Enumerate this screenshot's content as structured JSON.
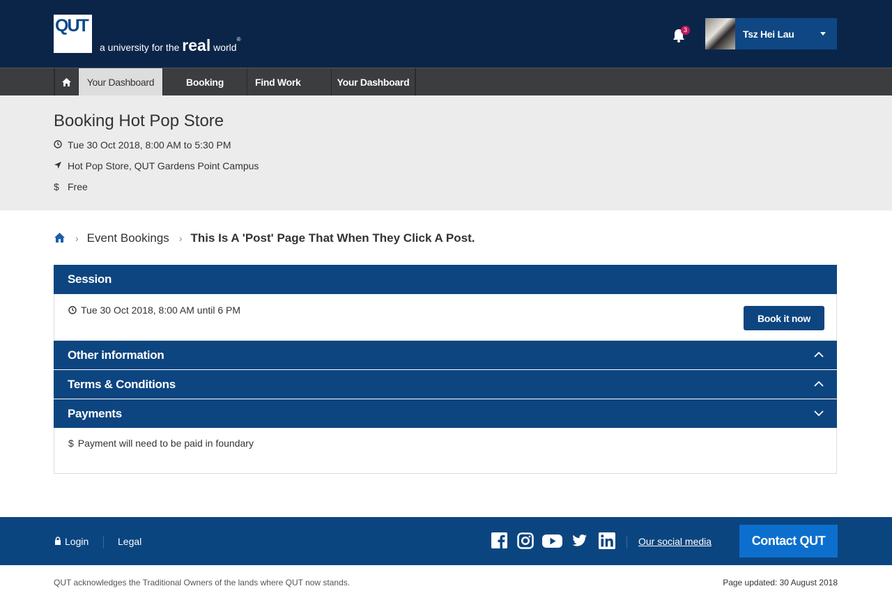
{
  "header": {
    "logo_text": "QUT",
    "tagline_prefix": "a university for the",
    "tagline_real": "real",
    "tagline_world": "world",
    "tagline_reg": "®",
    "notification_count": "3",
    "user_name": "Tsz Hei Lau"
  },
  "nav": {
    "items": [
      {
        "label": "Your Dashboard"
      },
      {
        "label": "Booking"
      },
      {
        "label": "Find Work"
      },
      {
        "label": "Your Dashboard"
      }
    ]
  },
  "event": {
    "title": "Booking Hot Pop Store",
    "datetime": "Tue 30 Oct 2018, 8:00 AM to 5:30 PM",
    "location": "Hot Pop Store, QUT Gardens Point Campus",
    "price": "Free"
  },
  "breadcrumb": {
    "items": [
      "Event Bookings",
      "This Is A 'Post' Page That When They Click A Post."
    ]
  },
  "session": {
    "heading": "Session",
    "time": "Tue 30 Oct 2018, 8:00 AM until 6 PM",
    "book_label": "Book it now"
  },
  "sections": {
    "other": "Other information",
    "terms": "Terms & Conditions",
    "payments": "Payments",
    "payment_note": "Payment will need to be paid in foundary"
  },
  "footer": {
    "login": "Login",
    "legal": "Legal",
    "social_link": "Our social media",
    "contact": "Contact QUT",
    "acknowledgement": "QUT acknowledges the Traditional Owners of the lands where QUT now stands.",
    "updated": "Page updated: 30 August 2018"
  },
  "colors": {
    "header_bg": "#0b2549",
    "primary": "#0d4580",
    "contact": "#0d6fcd",
    "badge": "#c0185e"
  }
}
